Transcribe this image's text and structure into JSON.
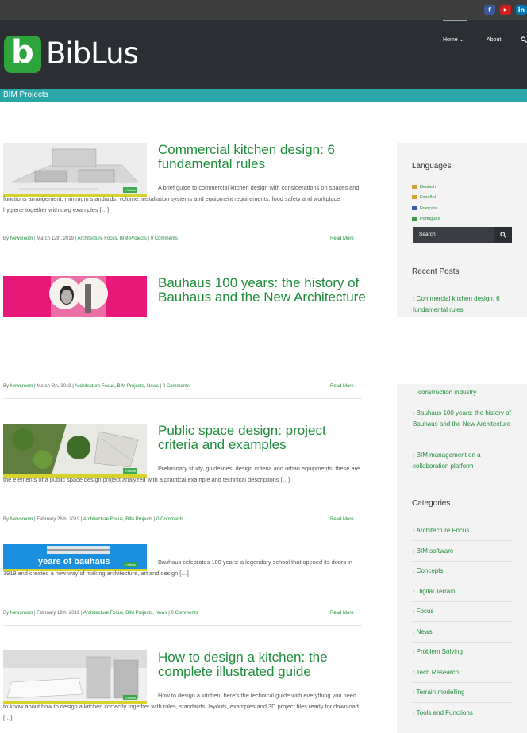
{
  "header": {
    "logo_text": "BibLus",
    "logo_badge": "b",
    "social": [
      "f",
      "▶",
      "in"
    ],
    "nav": {
      "home": "Home",
      "home_chevron": "⌄",
      "about": "About"
    },
    "search_icon": "search-icon"
  },
  "page_title": "BIM Projects",
  "posts": [
    {
      "title": "Commercial kitchen design: 6 fundamental rules",
      "excerpt": "A brief guide to commercial kitchen design with considerations on spaces and functions arrangement, minimum standards, volume, installation systems and equipment requirements, food safety and workplace hygiene together with dwg examples […]",
      "author": "Newsroom",
      "date": "March 12th, 2019",
      "categories": "Architecture Focus, BIM Projects",
      "comments": "0 Comments",
      "read_more": "Read More ›"
    },
    {
      "title": "Bauhaus 100 years: the history of Bauhaus and the New Architecture",
      "excerpt": "",
      "author": "Newsroom",
      "date": "March 5th, 2019",
      "categories": "Architecture Focus, BIM Projects, News",
      "comments": "0 Comments",
      "read_more": "Read More ›"
    },
    {
      "title": "Public space design: project criteria and examples",
      "excerpt": "Preliminary study, guidelines, design criteria and urban equipments: these are the elements of a public space design project analyzed with a practical example and technical descriptions […]",
      "author": "Newsroom",
      "date": "February 26th, 2019",
      "categories": "Architecture Focus, BIM Projects",
      "comments": "0 Comments",
      "read_more": "Read More ›"
    },
    {
      "title": "",
      "thumb_text": "years of bauhaus",
      "excerpt": "Bauhaus celebrates 100 years: a legendary school that opened its doors in 1919 and created a new way of making architecture, art and design […]",
      "author": "Newsroom",
      "date": "February 19th, 2019",
      "categories": "Architecture Focus, BIM Projects, News",
      "comments": "0 Comments",
      "read_more": "Read More ›"
    },
    {
      "title": "How to design a kitchen: the complete illustrated guide",
      "excerpt": "How to design a kitchen: here's the technical guide with everything you need to know about how to design a kitchen correctly together with rules, standards, layouts, examples and 3D project files ready for download […]"
    }
  ],
  "meta_by": "By",
  "thumb_watermark": "b biblus",
  "sidebar": {
    "languages_heading": "Languages",
    "languages": [
      "Deutsch",
      "Español",
      "Français",
      "Português"
    ],
    "flag_colors": [
      "#d2a03a",
      "#d8a23a",
      "#3c5aa8",
      "#3d9a3d"
    ],
    "search_placeholder": "Search",
    "recent_heading": "Recent Posts",
    "recent_top": "Commercial kitchen design: 6 fundamental rules",
    "recent_cut": "construction industry",
    "recent_more": [
      "Bauhaus 100 years: the history of Bauhaus and the New Architecture",
      "BIM management on a collaboration platform"
    ],
    "categories_heading": "Categories",
    "categories": [
      "Architecture Focus",
      "BIM software",
      "Concepts",
      "Digital Terrain",
      "Focus",
      "News",
      "Problem Solving",
      "Tech Research",
      "Terrain modelling",
      "Tools and Functions"
    ]
  },
  "colors": {
    "accent_green": "#1e8c3b",
    "teal_bar": "#2aa6a8",
    "header_dark": "#2b2e33",
    "logo_green": "#2ea43d"
  }
}
